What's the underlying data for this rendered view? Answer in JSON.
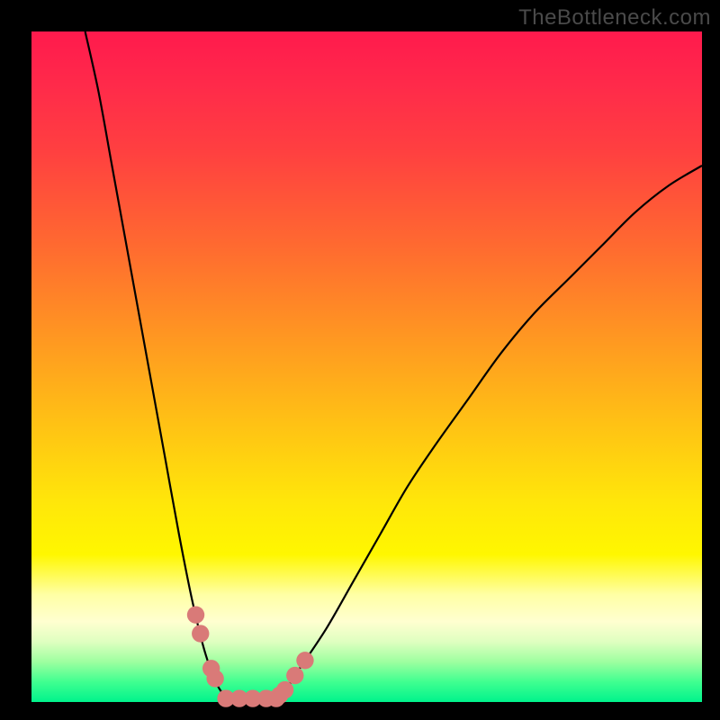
{
  "watermark": "TheBottleneck.com",
  "colors": {
    "accent_marker": "#d97a78",
    "curve_stroke": "#000000",
    "gradient_top": "#ff1a4d",
    "gradient_bottom": "#00f38c"
  },
  "chart_data": {
    "type": "line",
    "title": "",
    "xlabel": "",
    "ylabel": "",
    "xlim": [
      0,
      100
    ],
    "ylim": [
      0,
      100
    ],
    "grid": false,
    "legend": false,
    "description": "Bottleneck-style absolute-deviation curve; y ≈ 100 at edges, y ≈ 0 near the trough at x≈28–38. Left branch is steep, right branch is shallower.",
    "series": [
      {
        "name": "left-branch",
        "x": [
          8,
          10,
          12,
          14,
          16,
          18,
          20,
          22,
          24,
          26,
          28,
          30
        ],
        "y": [
          100,
          91,
          80,
          69,
          58,
          47,
          36,
          25,
          15,
          7,
          2,
          0
        ]
      },
      {
        "name": "right-branch",
        "x": [
          36,
          38,
          40,
          44,
          48,
          52,
          56,
          60,
          65,
          70,
          75,
          80,
          85,
          90,
          95,
          100
        ],
        "y": [
          0,
          2,
          5,
          11,
          18,
          25,
          32,
          38,
          45,
          52,
          58,
          63,
          68,
          73,
          77,
          80
        ]
      }
    ],
    "trough_markers": {
      "left_cluster_x": [
        24.5,
        25.2,
        26.8,
        27.4
      ],
      "right_cluster_x": [
        37.0,
        37.8,
        39.3,
        40.8
      ],
      "floor_dots_x": [
        29,
        31,
        33,
        35,
        36.5
      ],
      "marker_radius_pct": 1.3
    }
  }
}
